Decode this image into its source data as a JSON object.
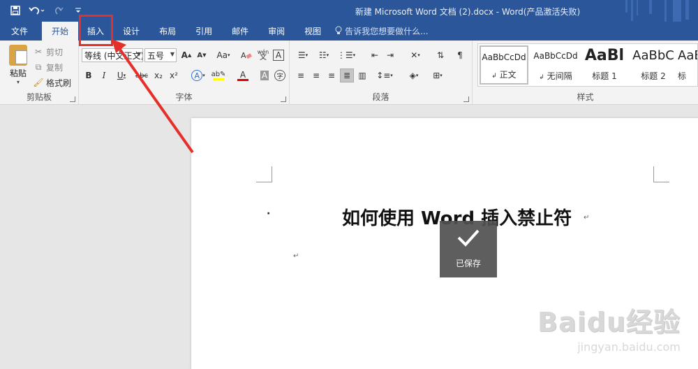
{
  "window": {
    "title": "新建 Microsoft Word 文档 (2).docx - Word(产品激活失败)"
  },
  "quick_access": {
    "save_icon": "save-icon",
    "undo_icon": "undo-icon",
    "redo_icon": "redo-icon",
    "customize_icon": "customize-qat-icon"
  },
  "tabs": [
    "文件",
    "开始",
    "插入",
    "设计",
    "布局",
    "引用",
    "邮件",
    "审阅",
    "视图"
  ],
  "active_tab": "开始",
  "tell_me": "告诉我您想要做什么...",
  "clipboard": {
    "label": "剪贴板",
    "paste": "粘贴",
    "cut": "剪切",
    "copy": "复制",
    "format_painter": "格式刷"
  },
  "font": {
    "label": "字体",
    "font_name": "等线 (中文正文)",
    "font_size": "五号",
    "grow": "A",
    "shrink": "A",
    "change_case": "Aa",
    "bold": "B",
    "italic": "I",
    "underline": "U",
    "strikethrough": "abc",
    "subscript": "x₂",
    "superscript": "x²",
    "wen": "wén",
    "boxed_a": "A",
    "text_effects": "A",
    "font_color": "A",
    "char_shading": "A",
    "enclosed_char": "字"
  },
  "paragraph": {
    "label": "段落"
  },
  "styles": {
    "label": "样式",
    "items": [
      {
        "sample": "AaBbCcDd",
        "name": "正文"
      },
      {
        "sample": "AaBbCcDd",
        "name": "无间隔"
      },
      {
        "sample": "AaBl",
        "name": "标题 1"
      },
      {
        "sample": "AaBbC",
        "name": "标题 2"
      },
      {
        "sample": "AaB",
        "name": "标"
      }
    ]
  },
  "document": {
    "bullet": "·",
    "heading": "如何使用 Word 插入禁止符",
    "paragraph_mark": "↵"
  },
  "toast": {
    "text": "已保存"
  },
  "watermark": {
    "brand": "Baidu经验",
    "url": "jingyan.baidu.com"
  },
  "colors": {
    "title_bar": "#2b579a",
    "ribbon": "#f3f3f3",
    "annotation": "#e5302a",
    "highlight_yellow": "#ffff00",
    "font_red": "#e00000"
  }
}
